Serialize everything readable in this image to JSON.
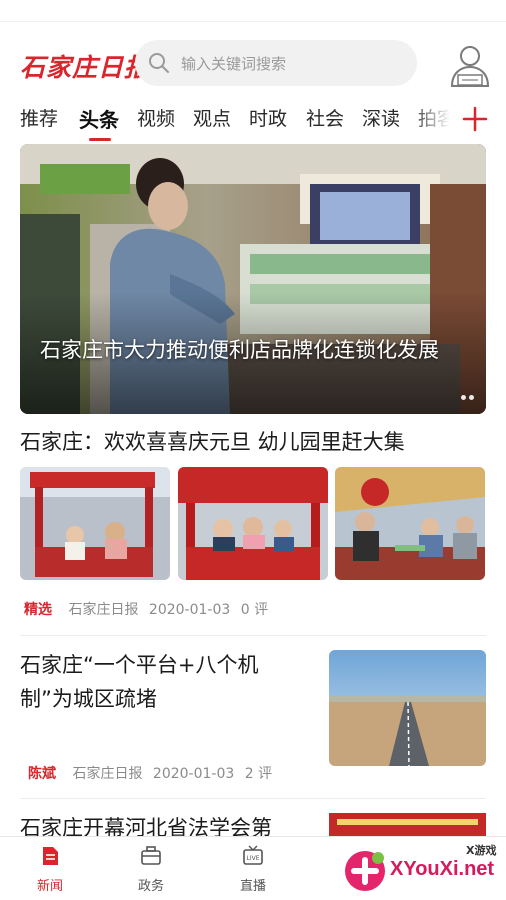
{
  "header": {
    "logo_text": "石家庄日报",
    "search_placeholder": "输入关键词搜索",
    "user_icon": "user-icon"
  },
  "tabs": [
    {
      "label": "推荐"
    },
    {
      "label": "头条",
      "active": true
    },
    {
      "label": "视频"
    },
    {
      "label": "观点"
    },
    {
      "label": "时政"
    },
    {
      "label": "社会"
    },
    {
      "label": "深读"
    },
    {
      "label": "拍客"
    }
  ],
  "banner": {
    "title": "石家庄市大力推动便利店品牌化连锁化发展"
  },
  "articles": [
    {
      "title": "石家庄：欢欢喜喜庆元旦 幼儿园里赶大集",
      "tag": "精选",
      "source": "石家庄日报",
      "date": "2020-01-03",
      "comments": "0 评"
    },
    {
      "title": "石家庄“一个平台+八个机制”为城区疏堵",
      "tag": "陈斌",
      "source": "石家庄日报",
      "date": "2020-01-03",
      "comments": "2 评"
    },
    {
      "title": "石家庄开幕河北省法学会第"
    }
  ],
  "bottom_nav": [
    {
      "label": "新闻",
      "icon": "news-icon",
      "active": true
    },
    {
      "label": "政务",
      "icon": "briefcase-icon"
    },
    {
      "label": "直播",
      "icon": "live-tv-icon"
    }
  ],
  "watermark": {
    "text": "XYouXi.net",
    "small": "X游戏"
  },
  "colors": {
    "brand_red": "#d8262c",
    "muted_text": "#8b8b8b"
  }
}
